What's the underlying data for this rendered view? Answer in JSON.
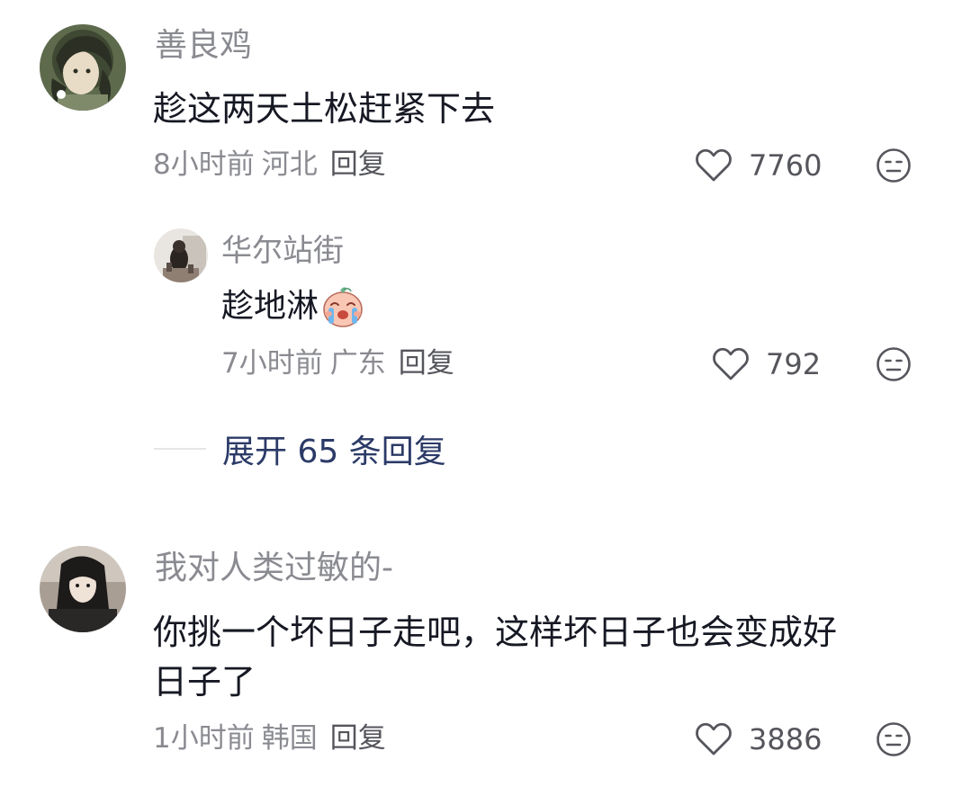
{
  "comments": [
    {
      "username": "善良鸡",
      "text": "趁这两天土松赶紧下去",
      "time": "8小时前",
      "location": "河北",
      "reply_label": "回复",
      "likes": "7760"
    },
    {
      "username": "华尔站街",
      "text": "趁地淋",
      "emoji": "crying-face-sticker",
      "time": "7小时前",
      "location": "广东",
      "reply_label": "回复",
      "likes": "792"
    },
    {
      "username": "我对人类过敏的-",
      "text_line1": "你挑一个坏日子走吧，这样坏日子也会变成好",
      "text_line2": "日子了",
      "time": "1小时前",
      "location": "韩国",
      "reply_label": "回复",
      "likes": "3886"
    }
  ],
  "expand_replies": "展开 65 条回复",
  "icons": {
    "like": "heart-outline-icon",
    "dislike": "meh-face-icon"
  },
  "colors": {
    "username": "#8a8b91",
    "text": "#161823",
    "expand": "#2b3a67"
  }
}
